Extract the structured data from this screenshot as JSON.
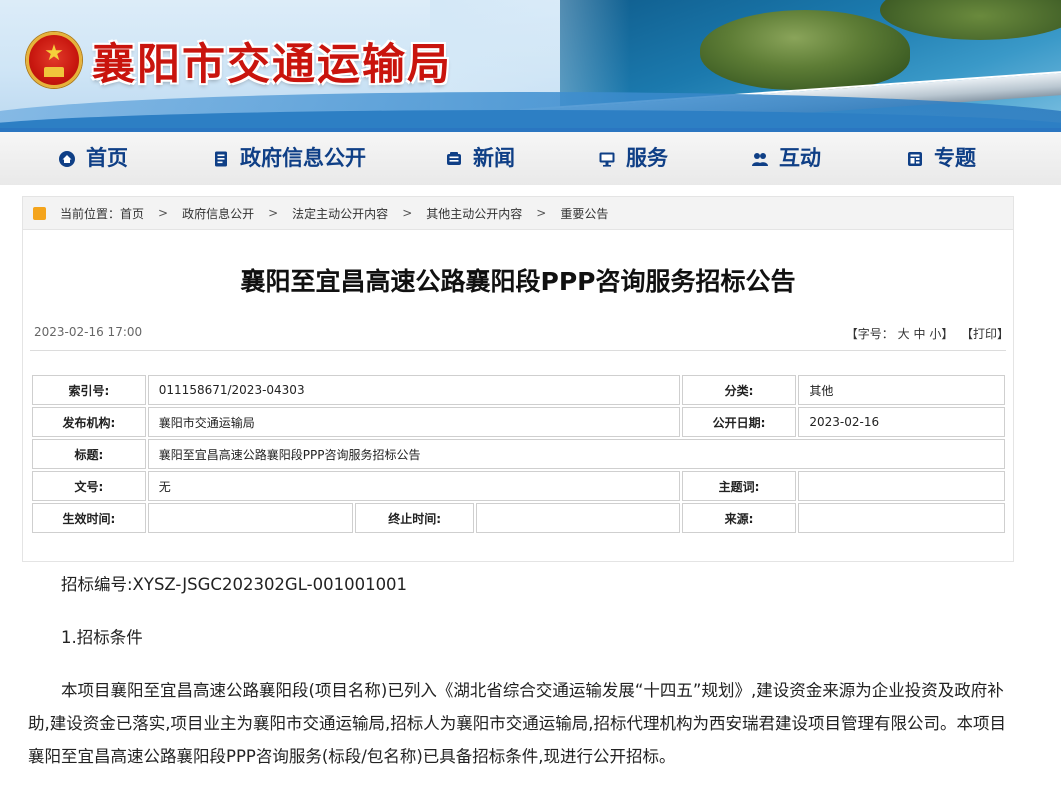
{
  "site": {
    "title": "襄阳市交通运输局"
  },
  "nav": [
    {
      "label": "首页",
      "icon": "home-icon"
    },
    {
      "label": "政府信息公开",
      "icon": "document-icon"
    },
    {
      "label": "新闻",
      "icon": "news-icon"
    },
    {
      "label": "服务",
      "icon": "monitor-icon"
    },
    {
      "label": "互动",
      "icon": "chat-icon"
    },
    {
      "label": "专题",
      "icon": "topic-icon"
    }
  ],
  "breadcrumb": {
    "prefix": "当前位置：",
    "items": [
      "首页",
      "政府信息公开",
      "法定主动公开内容",
      "其他主动公开内容",
      "重要公告"
    ],
    "separator": ">"
  },
  "article": {
    "title": "襄阳至宜昌高速公路襄阳段PPP咨询服务招标公告",
    "datetime": "2023-02-16 17:00",
    "font_size_label": "【字号：",
    "font_large": "大",
    "font_medium": "中",
    "font_small": "小",
    "font_close": "】",
    "print_label": "【打印】"
  },
  "info": {
    "index_label": "索引号:",
    "index_value": "011158671/2023-04303",
    "category_label": "分类:",
    "category_value": "其他",
    "publisher_label": "发布机构:",
    "publisher_value": "襄阳市交通运输局",
    "open_date_label": "公开日期:",
    "open_date_value": "2023-02-16",
    "title_label": "标题:",
    "title_value": "襄阳至宜昌高速公路襄阳段PPP咨询服务招标公告",
    "doc_no_label": "文号:",
    "doc_no_value": "无",
    "subject_label": "主题词:",
    "subject_value": "",
    "effective_label": "生效时间:",
    "effective_value": "",
    "end_label": "终止时间:",
    "end_value": "",
    "source_label": "来源:",
    "source_value": ""
  },
  "content": {
    "p1": "招标编号:XYSZ-JSGC202302GL-001001001",
    "p2": "1.招标条件",
    "p3": "本项目襄阳至宜昌高速公路襄阳段(项目名称)已列入《湖北省综合交通运输发展“十四五”规划》,建设资金来源为企业投资及政府补助,建设资金已落实,项目业主为襄阳市交通运输局,招标人为襄阳市交通运输局,招标代理机构为西安瑞君建设项目管理有限公司。本项目襄阳至宜昌高速公路襄阳段PPP咨询服务(标段/包名称)已具备招标条件,现进行公开招标。"
  },
  "colors": {
    "title_red": "#c9140d",
    "nav_text": "#0f3f86",
    "accent_blue": "#2a76c1"
  }
}
